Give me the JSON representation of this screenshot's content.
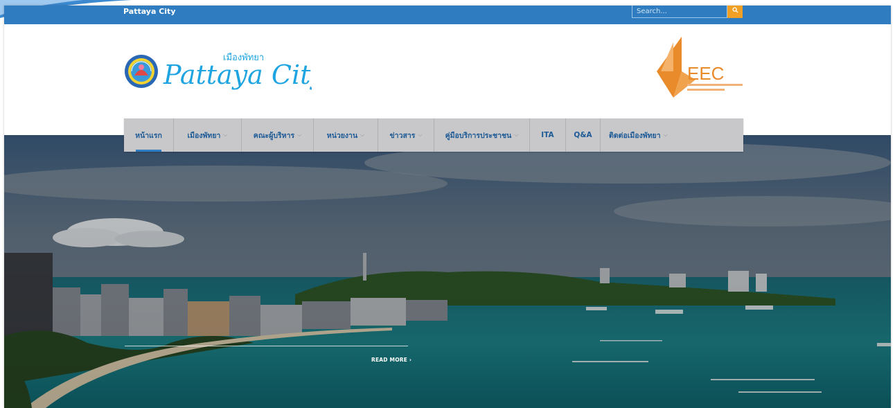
{
  "topbar": {
    "site_name": "Pattaya City",
    "search_placeholder": "Search..."
  },
  "header": {
    "logo_text": "Pattaya City",
    "logo_thai": "เมืองพัทยา",
    "eec_text": "EEC"
  },
  "nav": {
    "items": [
      {
        "label": "หน้าแรก",
        "dropdown": false,
        "active": true
      },
      {
        "label": "เมืองพัทยา",
        "dropdown": true
      },
      {
        "label": "คณะผู้บริหาร",
        "dropdown": true
      },
      {
        "label": "หน่วยงาน",
        "dropdown": true
      },
      {
        "label": "ข่าวสาร",
        "dropdown": true
      },
      {
        "label": "คู่มือบริการประชาชน",
        "dropdown": true
      },
      {
        "label": "ITA",
        "dropdown": false
      },
      {
        "label": "Q&A",
        "dropdown": false
      },
      {
        "label": "ติดต่อเมืองพัทยา",
        "dropdown": true
      }
    ]
  },
  "hero": {
    "read_more": "READ MORE ›"
  },
  "colors": {
    "topbar": "#2f7dc0",
    "nav_bg": "#c8c8ca",
    "nav_text": "#1e5a96",
    "search_button": "#f0a024",
    "eec_orange": "#e98a2b"
  }
}
